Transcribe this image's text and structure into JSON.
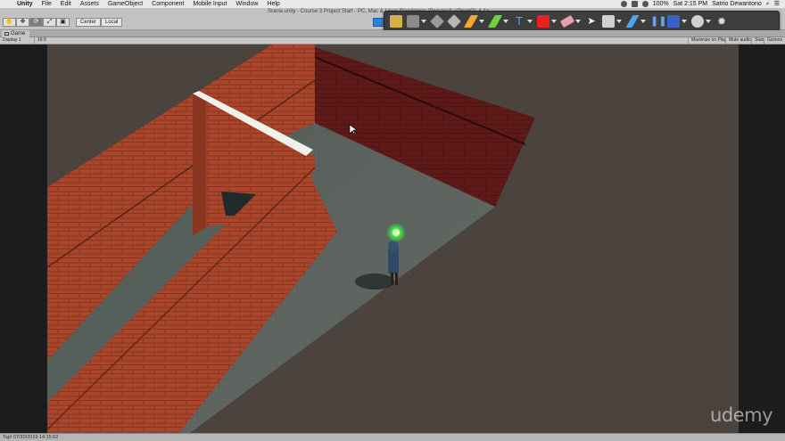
{
  "menubar": {
    "apple_glyph": "",
    "items": [
      "Unity",
      "File",
      "Edit",
      "Assets",
      "GameObject",
      "Component",
      "Mobile Input",
      "Window",
      "Help"
    ],
    "battery": "100%",
    "clock": "Sat 2:15 PM",
    "user": "Satrio Dewantono"
  },
  "toolbar": {
    "scene_title": "Scene.unity - Course 3 Project Start - PC, Mac & Linux Standalone (Personal) <OpenGL 4.1>",
    "transform_tools": [
      "✋",
      "✥",
      "⟳",
      "⤢",
      "▣"
    ],
    "pivot_label": "Center",
    "space_label": "Local",
    "right_buttons": [
      "Maximize on Play",
      "Mute audio",
      "Stats",
      "Gizmos"
    ]
  },
  "palette": {
    "icons": [
      "folder-icon",
      "stack-icon",
      "cube-icon",
      "cube-icon",
      "pencil-icon",
      "highlighter-icon",
      "text-icon",
      "shape-icon",
      "eraser-icon",
      "pointer-icon",
      "rectangle-icon",
      "pen-icon",
      "pause-icon",
      "record-icon",
      "webcam-icon",
      "settings-icon"
    ],
    "colors": {
      "bg": "#3d3d3d",
      "pencil": "#f2a830",
      "highlighter": "#6ed040",
      "text": "#4aa8e8",
      "shape": "#e82020"
    }
  },
  "tab": {
    "label": "Game"
  },
  "gamebar": {
    "display": "Display 1",
    "aspect": "16:9",
    "maximize": "Maximize on Play",
    "mute": "Mute audio",
    "stats": "Stats",
    "gizmos": "Gizmos"
  },
  "status": {
    "text": "Tap! 07/20/2019 14:15:52"
  },
  "watermark": "udemy",
  "colors": {
    "brick": "#a8452a",
    "floor": "#5d6560",
    "dark_wall": "#5e1a18",
    "glow": "#3ee64a"
  }
}
